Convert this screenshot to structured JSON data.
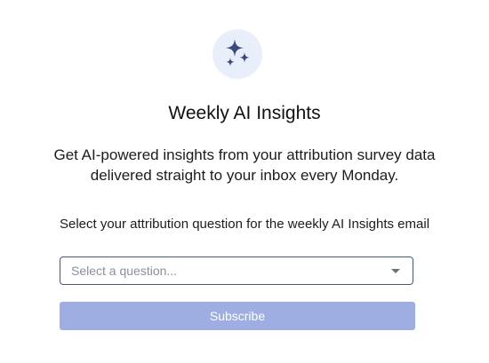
{
  "header": {
    "icon": "sparkles-icon",
    "title": "Weekly AI Insights",
    "subtitle": "Get AI-powered insights from your attribution survey data delivered straight to your inbox every Monday."
  },
  "form": {
    "question_label": "Select your attribution question for the weekly AI Insights email",
    "select_placeholder": "Select a question...",
    "subscribe_label": "Subscribe",
    "subscribe_disabled": true
  },
  "colors": {
    "icon_bg": "#e9eefb",
    "icon_fg": "#3a4a7a",
    "button_bg": "#9eaee3",
    "select_border": "#4a5778"
  }
}
